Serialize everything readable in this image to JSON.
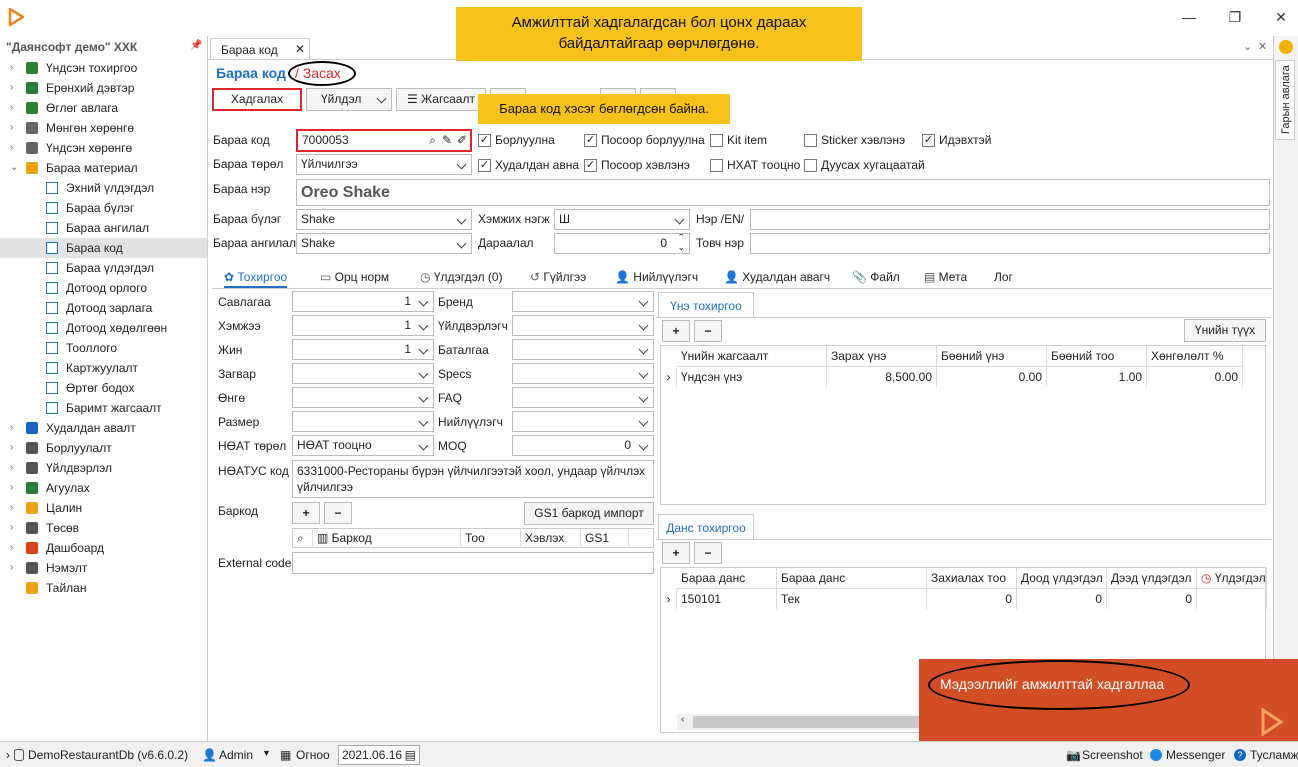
{
  "window": {
    "min": "—",
    "max": "❐",
    "close": "✕"
  },
  "sidebar": {
    "company": "\"Даянсофт демо\" ХХК",
    "items": [
      {
        "label": "Үндсэн тохиргоо",
        "level": 0,
        "color": "#2e7d32"
      },
      {
        "label": "Ерөнхий дэвтэр",
        "level": 0,
        "color": "#2e7d32"
      },
      {
        "label": "Өглөг авлага",
        "level": 0,
        "color": "#2e7d32"
      },
      {
        "label": "Мөнгөн хөрөнгө",
        "level": 0,
        "color": "#666"
      },
      {
        "label": "Үндсэн хөрөнгө",
        "level": 0,
        "color": "#666"
      },
      {
        "label": "Бараа материал",
        "level": 0,
        "color": "#e8a317",
        "open": true
      },
      {
        "label": "Эхний үлдэгдэл",
        "level": 1
      },
      {
        "label": "Бараа бүлэг",
        "level": 1
      },
      {
        "label": "Бараа ангилал",
        "level": 1
      },
      {
        "label": "Бараа код",
        "level": 1,
        "selected": true
      },
      {
        "label": "Бараа үлдэгдэл",
        "level": 1
      },
      {
        "label": "Дотоод орлого",
        "level": 1
      },
      {
        "label": "Дотоод зарлага",
        "level": 1
      },
      {
        "label": "Дотоод хөдөлгөөн",
        "level": 1
      },
      {
        "label": "Тооллого",
        "level": 1
      },
      {
        "label": "Картжуулалт",
        "level": 1
      },
      {
        "label": "Өртөг бодох",
        "level": 1
      },
      {
        "label": "Баримт жагсаалт",
        "level": 1
      },
      {
        "label": "Худалдан авалт",
        "level": 0,
        "color": "#1565c0"
      },
      {
        "label": "Борлуулалт",
        "level": 0,
        "color": "#555"
      },
      {
        "label": "Үйлдвэрлэл",
        "level": 0,
        "color": "#555"
      },
      {
        "label": "Агуулах",
        "level": 0,
        "color": "#2e7d32"
      },
      {
        "label": "Цалин",
        "level": 0,
        "color": "#e8a317"
      },
      {
        "label": "Төсөв",
        "level": 0,
        "color": "#555"
      },
      {
        "label": "Дашбоард",
        "level": 0,
        "color": "#d84315"
      },
      {
        "label": "Нэмэлт",
        "level": 0,
        "color": "#555"
      },
      {
        "label": "Тайлан",
        "level": 0,
        "color": "#e8a317",
        "noarrow": true
      }
    ]
  },
  "doctab": {
    "label": "Бараа код",
    "close": "✕"
  },
  "breadcrumb": {
    "main": "Бараа код",
    "sub": "/ Засах"
  },
  "toolbar": {
    "save": "Хадгалах",
    "action": "Үйлдэл",
    "list": "Жагсаалт"
  },
  "banners": {
    "top": "Амжилттай хадгалагдсан бол цонх дараах байдалтайгаар өөрчлөгдөнө.",
    "mid": "Бараа код хэсэг бөглөгдсөн байна."
  },
  "form": {
    "code_label": "Бараа код",
    "code_value": "7000053",
    "type_label": "Бараа төрөл",
    "type_value": "Үйлчилгээ",
    "name_label": "Бараа нэр",
    "name_value": "Oreo Shake",
    "group_label": "Бараа бүлэг",
    "group_value": "Shake",
    "class_label": "Бараа ангилал",
    "class_value": "Shake",
    "unit_label": "Хэмжих нэгж",
    "unit_value": "Ш",
    "order_label": "Дараалал",
    "order_value": "0",
    "en_label": "Нэр /EN/",
    "short_label": "Товч нэр",
    "checks": [
      {
        "label": "Борлуулна",
        "checked": true
      },
      {
        "label": "Посоор борлуулна",
        "checked": true
      },
      {
        "label": "Kit item",
        "checked": false
      },
      {
        "label": "Sticker хэвлэнэ",
        "checked": false
      },
      {
        "label": "Идэвхтэй",
        "checked": true
      },
      {
        "label": "Худалдан авна",
        "checked": true
      },
      {
        "label": "Посоор хэвлэнэ",
        "checked": true
      },
      {
        "label": "НХАТ тооцно",
        "checked": false
      },
      {
        "label": "Дуусах хугацаатай",
        "checked": false
      }
    ]
  },
  "subtabs": [
    "Тохиргоо",
    "Орц норм",
    "Үлдэгдэл (0)",
    "Гүйлгээ",
    "Нийлүүлэгч",
    "Худалдан авагч",
    "Файл",
    "Мета",
    "Лог"
  ],
  "settings": {
    "left": [
      {
        "label": "Савлагаа",
        "value": "1",
        "kind": "num"
      },
      {
        "label": "Хэмжээ",
        "value": "1",
        "kind": "num"
      },
      {
        "label": "Жин",
        "value": "1",
        "kind": "num"
      },
      {
        "label": "Загвар",
        "value": "",
        "kind": "dd"
      },
      {
        "label": "Өнгө",
        "value": "",
        "kind": "dd"
      },
      {
        "label": "Размер",
        "value": "",
        "kind": "dd"
      },
      {
        "label": "НӨАТ төрөл",
        "value": "НӨАТ тооцно",
        "kind": "dd"
      }
    ],
    "right": [
      {
        "label": "Бренд",
        "value": ""
      },
      {
        "label": "Үйлдвэрлэгч",
        "value": ""
      },
      {
        "label": "Баталгаа",
        "value": ""
      },
      {
        "label": "Specs",
        "value": ""
      },
      {
        "label": "FAQ",
        "value": ""
      },
      {
        "label": "Нийлүүлэгч",
        "value": ""
      },
      {
        "label": "MOQ",
        "value": "0"
      }
    ],
    "vat_label": "НӨАТУС код",
    "vat_value": "6331000-Рестораны бүрэн үйлчилгээтэй хоол, ундаар үйлчлэх үйлчилгээ",
    "barcode_label": "Баркод",
    "gs1": "GS1 баркод импорт",
    "barcode_cols": [
      "Баркод",
      "Тоо",
      "Хэвлэх",
      "GS1"
    ],
    "external_label": "External code"
  },
  "price": {
    "tab": "Үнэ тохиргоо",
    "history": "Үнийн түүх",
    "cols": [
      "Үнийн жагсаалт",
      "Зарах үнэ",
      "Бөөний үнэ",
      "Бөөний тоо",
      "Хөнгөлөлт %"
    ],
    "row": [
      "Үндсэн үнэ",
      "8,500.00",
      "0.00",
      "1.00",
      "0.00"
    ]
  },
  "account": {
    "tab": "Данс тохиргоо",
    "cols": [
      "Бараа данс",
      "Бараа данс",
      "Захиалах тоо",
      "Доод үлдэгдэл",
      "Дээд үлдэгдэл",
      "Үлдэгдэл"
    ],
    "row": [
      "150101",
      "Тек",
      "0",
      "0",
      "0",
      ""
    ]
  },
  "right_tab": "Гарын авлага",
  "toast": {
    "text": "Мэдээллийг амжилттай хадгаллаа",
    "color": "#d24d26"
  },
  "status": {
    "db": "DemoRestaurantDb (v6.6.0.2)",
    "user": "Admin",
    "period_label": "Огноо",
    "date": "2021.06.16",
    "screenshot": "Screenshot",
    "messenger": "Messenger",
    "help": "Тусламж"
  },
  "colors": {
    "accent": "#1f6fc5",
    "red": "#e0262a",
    "banner": "#f7c21b"
  }
}
